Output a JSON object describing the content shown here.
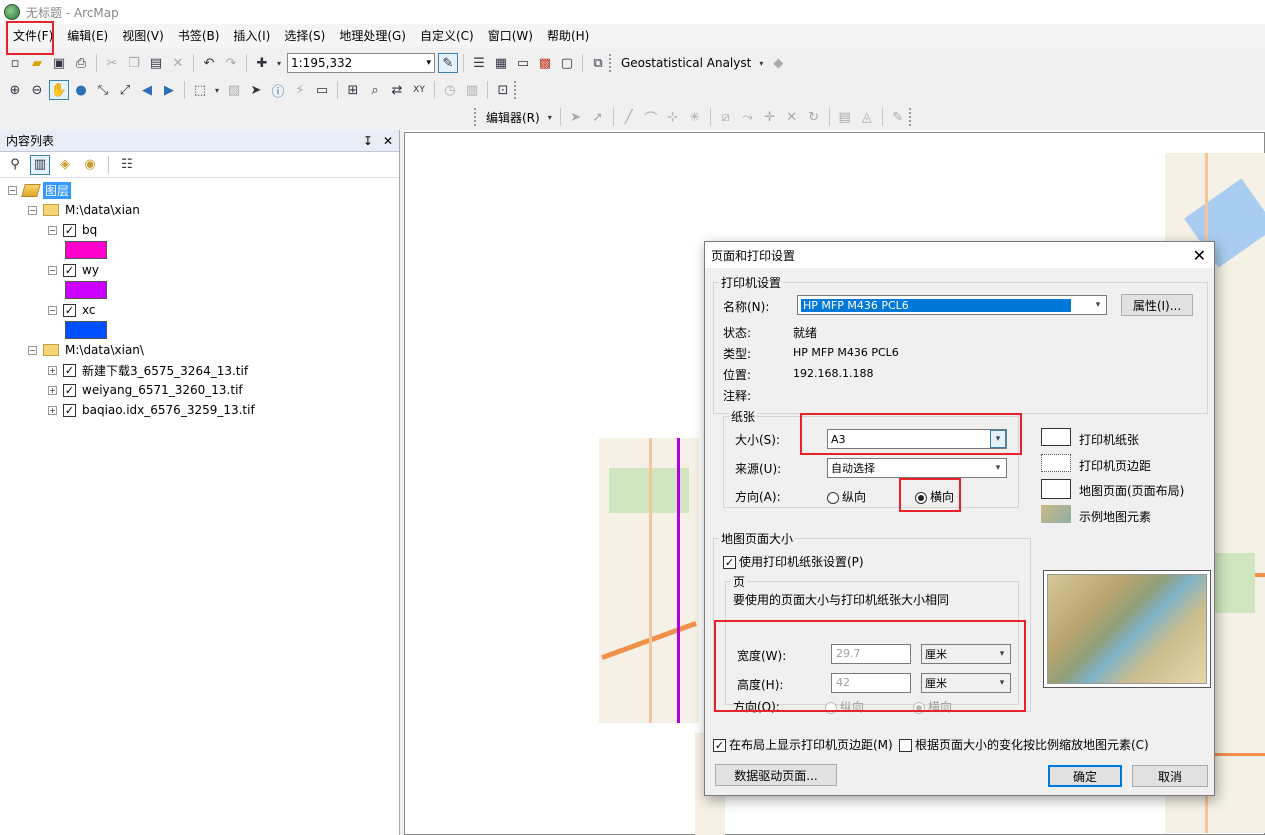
{
  "window": {
    "title": "无标题 - ArcMap"
  },
  "menu": [
    "文件(F)",
    "编辑(E)",
    "视图(V)",
    "书签(B)",
    "插入(I)",
    "选择(S)",
    "地理处理(G)",
    "自定义(C)",
    "窗口(W)",
    "帮助(H)"
  ],
  "toolbar": {
    "scale": "1:195,332",
    "geostat": "Geostatistical Analyst",
    "editor": "编辑器(R)"
  },
  "toc": {
    "title": "内容列表",
    "pin": "↧",
    "close": "✕",
    "root": "图层",
    "folder1": "M:\\data\\xian",
    "layers": [
      {
        "name": "bq",
        "color": "#ff00cc"
      },
      {
        "name": "wy",
        "color": "#cc00ff"
      },
      {
        "name": "xc",
        "color": "#0050ff"
      }
    ],
    "folder2": "M:\\data\\xian\\",
    "rasters": [
      "新建下载3_6575_3264_13.tif",
      "weiyang_6571_3260_13.tif",
      "baqiao.idx_6576_3259_13.tif"
    ]
  },
  "dialog": {
    "title": "页面和打印设置",
    "printer_group": "打印机设置",
    "name_label": "名称(N):",
    "printer_name": "HP MFP M436 PCL6",
    "properties_btn": "属性(I)...",
    "status_label": "状态:",
    "status_value": "就绪",
    "type_label": "类型:",
    "type_value": "HP MFP M436 PCL6",
    "location_label": "位置:",
    "location_value": "192.168.1.188",
    "comment_label": "注释:",
    "paper_group": "纸张",
    "size_label": "大小(S):",
    "size_value": "A3",
    "source_label": "来源(U):",
    "source_value": "自动选择",
    "orient_label": "方向(A):",
    "portrait": "纵向",
    "landscape": "横向",
    "legend": [
      "打印机纸张",
      "打印机页边距",
      "地图页面(页面布局)",
      "示例地图元素"
    ],
    "map_size_group": "地图页面大小",
    "use_printer_check": "使用打印机纸张设置(P)",
    "page_group": "页",
    "page_note": "要使用的页面大小与打印机纸张大小相同",
    "width_label": "宽度(W):",
    "width_value": "29.7",
    "width_unit": "厘米",
    "height_label": "高度(H):",
    "height_value": "42",
    "height_unit": "厘米",
    "page_orient_label": "方向(O):",
    "page_portrait": "纵向",
    "page_landscape": "横向",
    "show_margins": "在布局上显示打印机页边距(M)",
    "scale_elements": "根据页面大小的变化按比例缩放地图元素(C)",
    "ddp_btn": "数据驱动页面...",
    "ok_btn": "确定",
    "cancel_btn": "取消"
  }
}
